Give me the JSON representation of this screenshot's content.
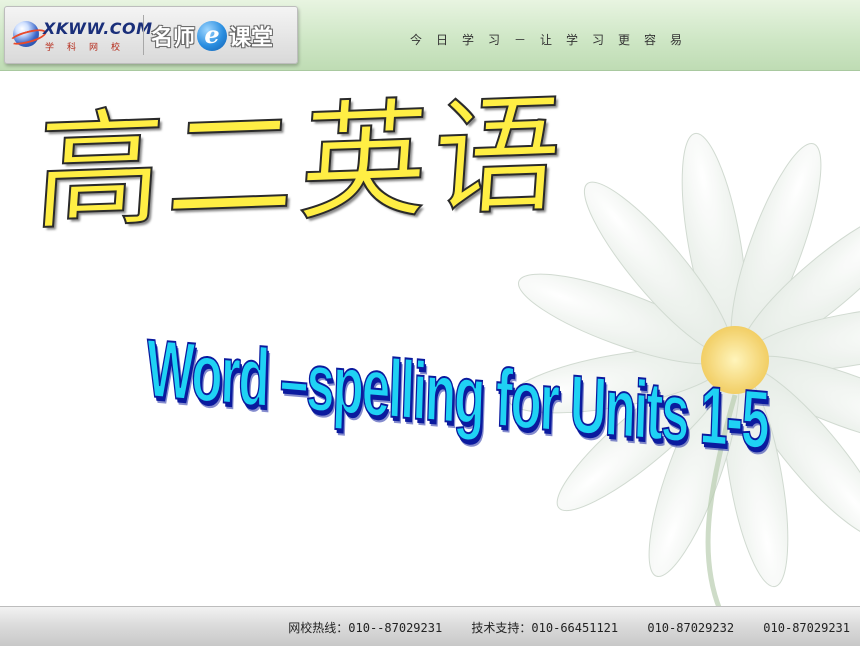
{
  "header": {
    "logo_site": "XKWW.COM",
    "logo_sub": "学科网校",
    "brand_left": "名师",
    "brand_e": "e",
    "brand_right": "课堂",
    "slogan": "今日学习－让学习更容易"
  },
  "slide": {
    "title_cn": "高二英语",
    "title_en": "Word –spelling for Units 1-5"
  },
  "footer": {
    "hotline": "网校热线：010--87029231",
    "support": "技术支持：010-66451121",
    "phone_2": "010-87029232",
    "phone_3": "010-87029231"
  },
  "colors": {
    "header_green": "#cfe7c6",
    "title_cn_fill": "#ffee44",
    "title_en_fill": "#1fd2f4",
    "title_en_outline": "#0b1a9e"
  }
}
